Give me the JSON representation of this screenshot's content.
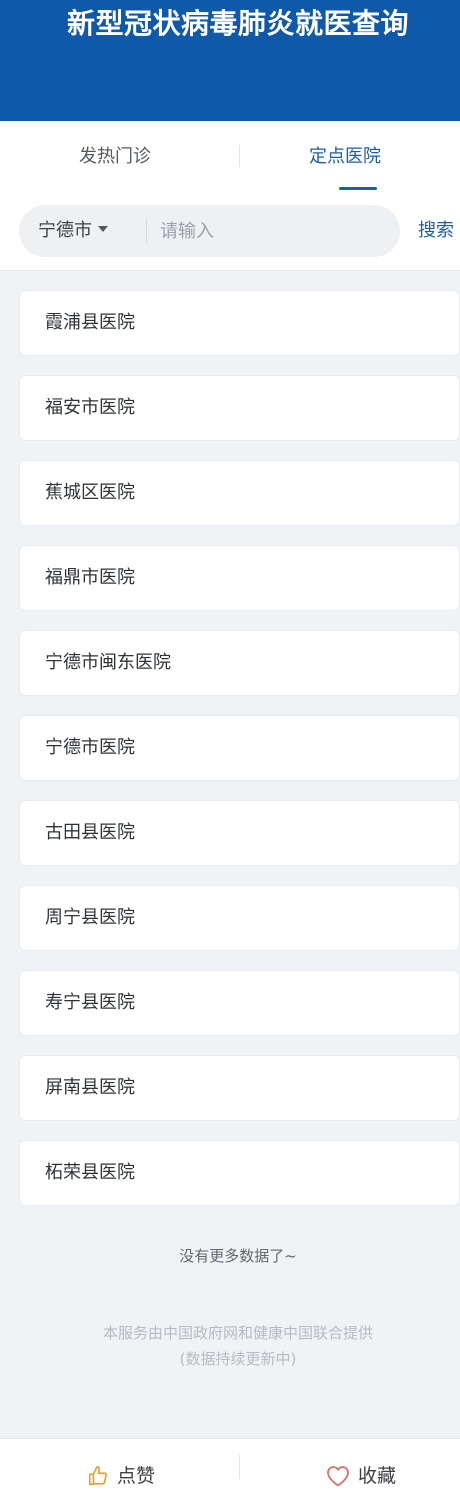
{
  "header": {
    "title": "新型冠状病毒肺炎就医查询"
  },
  "tabs": {
    "fever_clinic": "发热门诊",
    "designated_hospital": "定点医院",
    "active": "designated_hospital"
  },
  "search": {
    "city": "宁德市",
    "placeholder": "请输入",
    "value": "",
    "button_label": "搜索"
  },
  "hospitals": [
    "霞浦县医院",
    "福安市医院",
    "蕉城区医院",
    "福鼎市医院",
    "宁德市闽东医院",
    "宁德市医院",
    "古田县医院",
    "周宁县医院",
    "寿宁县医院",
    "屏南县医院",
    "柘荣县医院"
  ],
  "footer": {
    "no_more": "没有更多数据了~",
    "provider_line1": "本服务由中国政府网和健康中国联合提供",
    "provider_line2": "(数据持续更新中)"
  },
  "actions": {
    "like_label": "点赞",
    "like_icon": "thumbs-up-icon",
    "favorite_label": "收藏",
    "favorite_icon": "heart-icon"
  },
  "colors": {
    "brand_blue": "#1058a8",
    "active_tab": "#1b5ea8",
    "like_icon": "#e0a13a",
    "favorite_icon": "#e46a6a"
  }
}
